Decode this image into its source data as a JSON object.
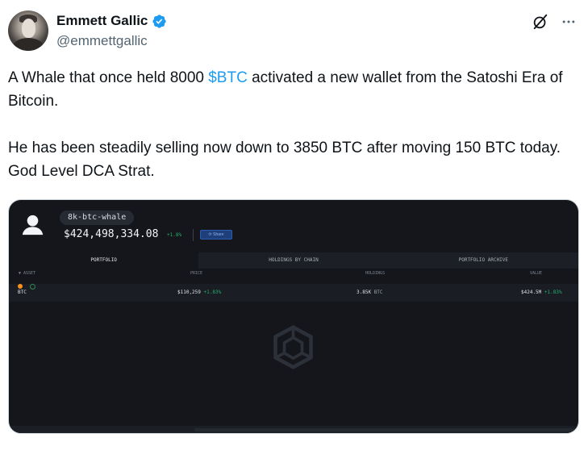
{
  "author": {
    "display_name": "Emmett Gallic",
    "handle": "@emmettgallic",
    "verified_color": "#1d9bf0"
  },
  "tweet": {
    "p1_prefix": "A Whale that once held 8000 ",
    "cashtag": "$BTC",
    "p1_suffix": " activated a new wallet from the Satoshi Era of Bitcoin.",
    "p2": "He has been steadily selling now down to 3850 BTC after moving 150 BTC today. God Level DCA Strat."
  },
  "media": {
    "entity_name": "8k-btc-whale",
    "total_value": "$424,498,334.08",
    "change": "+1.8%",
    "share_label": "Share",
    "tabs": [
      "PORTFOLIO",
      "HOLDINGS BY CHAIN",
      "PORTFOLIO ARCHIVE"
    ],
    "columns": {
      "asset": "ASSET",
      "price": "PRICE",
      "holdings": "HOLDINGS",
      "value": "VALUE"
    },
    "row": {
      "asset": "BTC",
      "price": "$110,259",
      "price_change": "+1.83%",
      "holdings": "3.85K",
      "holdings_unit": "BTC",
      "value": "$424.5M",
      "value_change": "+1.83%"
    }
  }
}
